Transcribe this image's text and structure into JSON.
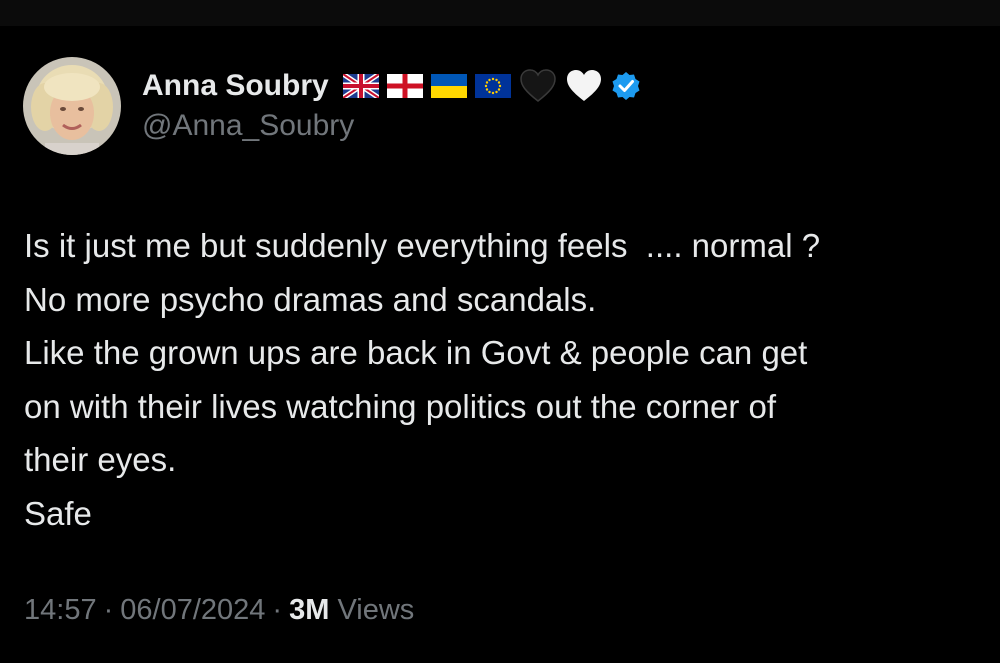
{
  "author": {
    "display_name": "Anna Soubry",
    "handle": "@Anna_Soubry",
    "name_emojis": [
      "uk-flag-icon",
      "england-flag-icon",
      "ukraine-flag-icon",
      "eu-flag-icon",
      "black-heart-icon",
      "white-heart-icon",
      "verified-badge-icon"
    ]
  },
  "tweet": {
    "lines": [
      "Is it just me but suddenly everything feels  .... normal ?",
      "No more psycho dramas and scandals.",
      "Like the grown ups are back in Govt & people can get",
      "on with their lives watching politics out the corner of",
      "their eyes.",
      "Safe"
    ]
  },
  "meta": {
    "time": "14:57",
    "separator": "·",
    "date": "06/07/2024",
    "views_count": "3M",
    "views_label": "Views"
  },
  "colors": {
    "background": "#000000",
    "text": "#e7e9ea",
    "secondary": "#71767b",
    "verified": "#1d9bf0"
  }
}
